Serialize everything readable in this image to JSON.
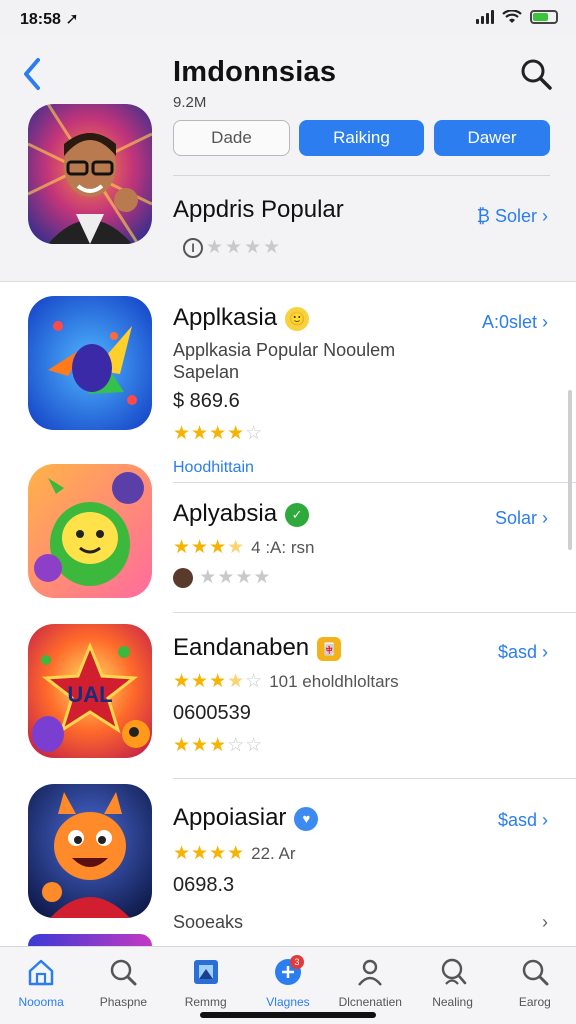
{
  "status": {
    "time": "18:58 ➚"
  },
  "header": {
    "title": "Imdonnsias",
    "count": "9.2M",
    "segments": [
      "Dade",
      "Raiking",
      "Dawer"
    ],
    "hero": {
      "name": "Appdris Popular",
      "action": "₿ Soler",
      "info": "I"
    }
  },
  "apps": [
    {
      "name": "Applkasia",
      "badge": "🙂",
      "desc": "Applkasia Popular Nooulem",
      "sub": "Sapelan",
      "price": "$ 869.6",
      "action": "A:0slet",
      "rating": 4
    },
    {
      "section": "Hoodhittain",
      "name": "Aplyabsia",
      "badge": "✓",
      "rev": "4 :A: rsn",
      "action": "Solar",
      "rating": 3.5
    },
    {
      "name": "Eandanaben",
      "badge": "🀄",
      "rev": "101 eholdhloltars",
      "price": "0600539",
      "action": "$asd",
      "rating": 3.5
    },
    {
      "name": "Appoiasiar",
      "badge": "♥",
      "rev": "22. Ar",
      "price": "0698.3",
      "action": "$asd",
      "rating": 4,
      "footer": "Sooeaks"
    }
  ],
  "tabs": [
    {
      "label": "Noooma",
      "icon": "home-icon",
      "active": true
    },
    {
      "label": "Phaspne",
      "icon": "search-icon"
    },
    {
      "label": "Remmg",
      "icon": "apps-icon"
    },
    {
      "label": "Vlagnes",
      "icon": "updates-icon",
      "badge": "3",
      "active": true
    },
    {
      "label": "Dlcnenatien",
      "icon": "profile-icon"
    },
    {
      "label": "Nealing",
      "icon": "search-profile-icon"
    },
    {
      "label": "Earog",
      "icon": "search-icon"
    }
  ],
  "colors": {
    "accent": "#2b7df0",
    "star": "#f4b400"
  }
}
